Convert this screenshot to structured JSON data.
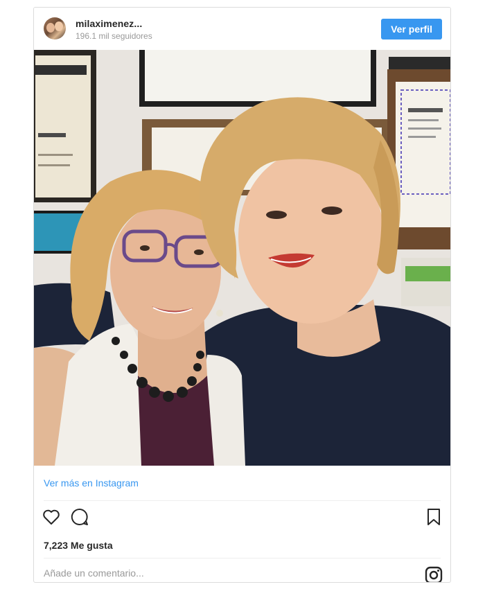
{
  "header": {
    "username": "milaximenez...",
    "followers": "196.1 mil seguidores",
    "profile_button": "Ver perfil"
  },
  "post": {
    "image_icon": "photo-two-women"
  },
  "footer": {
    "view_more": "Ver más en Instagram",
    "likes": "7,223 Me gusta",
    "comment_placeholder": "Añade un comentario...",
    "icons": [
      "heart-icon",
      "comment-icon",
      "bookmark-icon",
      "instagram-icon"
    ]
  },
  "colors": {
    "accent": "#3897f0",
    "text": "#262626",
    "muted": "#999999",
    "border": "#dbdbdb"
  }
}
